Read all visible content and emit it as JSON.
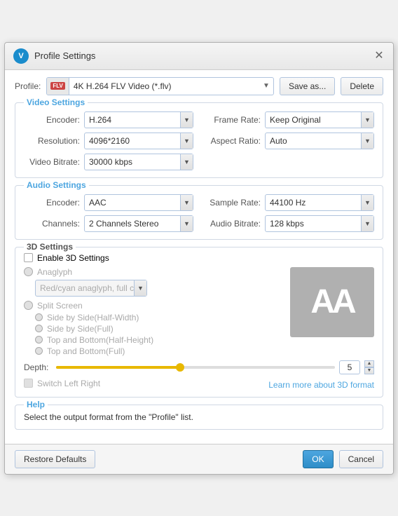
{
  "window": {
    "title": "Profile Settings",
    "app_icon": "V"
  },
  "profile": {
    "label": "Profile:",
    "value": "4K H.264 FLV Video (*.flv)",
    "badge": "FLV",
    "save_as": "Save as...",
    "delete": "Delete"
  },
  "video_settings": {
    "section_title": "Video Settings",
    "encoder_label": "Encoder:",
    "encoder_value": "H.264",
    "resolution_label": "Resolution:",
    "resolution_value": "4096*2160",
    "bitrate_label": "Video Bitrate:",
    "bitrate_value": "30000 kbps",
    "framerate_label": "Frame Rate:",
    "framerate_value": "Keep Original",
    "aspect_label": "Aspect Ratio:",
    "aspect_value": "Auto"
  },
  "audio_settings": {
    "section_title": "Audio Settings",
    "encoder_label": "Encoder:",
    "encoder_value": "AAC",
    "channels_label": "Channels:",
    "channels_value": "2 Channels Stereo",
    "samplerate_label": "Sample Rate:",
    "samplerate_value": "44100 Hz",
    "bitrate_label": "Audio Bitrate:",
    "bitrate_value": "128 kbps"
  },
  "settings_3d": {
    "section_title": "3D Settings",
    "enable_label": "Enable 3D Settings",
    "anaglyph_label": "Anaglyph",
    "anaglyph_option": "Red/cyan anaglyph, full color",
    "split_screen_label": "Split Screen",
    "side_half": "Side by Side(Half-Width)",
    "side_full": "Side by Side(Full)",
    "top_half": "Top and Bottom(Half-Height)",
    "top_full": "Top and Bottom(Full)",
    "depth_label": "Depth:",
    "depth_value": "5",
    "switch_label": "Switch Left Right",
    "learn_more": "Learn more about 3D format",
    "preview_text": "AA"
  },
  "help": {
    "section_title": "Help",
    "text": "Select the output format from the \"Profile\" list."
  },
  "footer": {
    "restore_label": "Restore Defaults",
    "ok_label": "OK",
    "cancel_label": "Cancel"
  }
}
